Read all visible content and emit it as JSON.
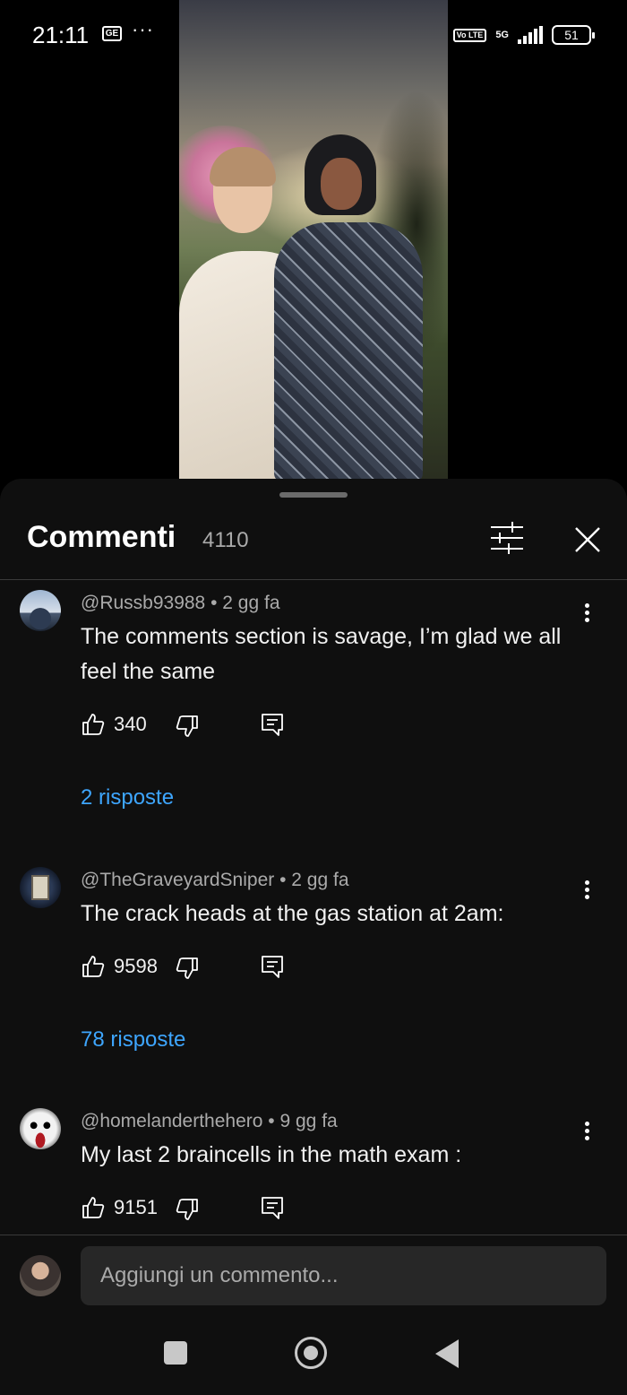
{
  "status_bar": {
    "time": "21:11",
    "carrier_badge": "GE",
    "overflow": "···",
    "volte": "Vo LTE",
    "network": "5G",
    "battery": "51"
  },
  "comments_panel": {
    "title": "Commenti",
    "count": "4110",
    "icons": {
      "filter": "sliders-icon",
      "close": "close-icon"
    }
  },
  "comments": [
    {
      "author": "@Russb93988",
      "age": "2 gg fa",
      "text": "The comments section is savage, I’m glad we all feel the same",
      "likes": "340",
      "replies": "2 risposte"
    },
    {
      "author": "@TheGraveyardSniper",
      "age": "2 gg fa",
      "text": "The crack heads at the gas station at 2am:",
      "likes": "9598",
      "replies": "78 risposte"
    },
    {
      "author": "@homelanderthehero",
      "age": "9 gg fa",
      "text": "My last 2 braincells in the math exam :",
      "likes": "9151"
    }
  ],
  "input": {
    "placeholder": "Aggiungi un commento..."
  },
  "colors": {
    "background": "#0f0f0f",
    "link": "#3ea6ff",
    "secondary_text": "#aaaaaa"
  }
}
